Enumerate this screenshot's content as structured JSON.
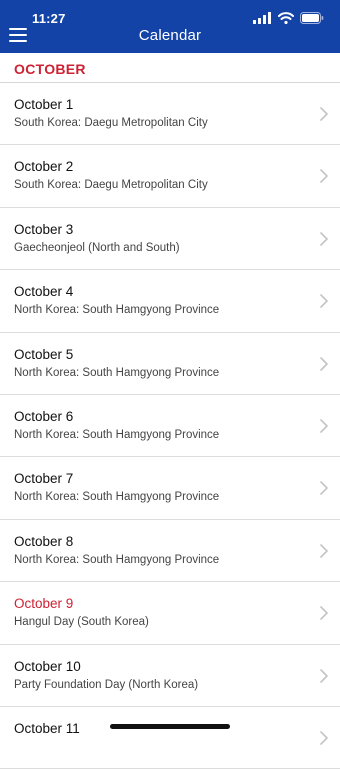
{
  "status_bar": {
    "time": "11:27"
  },
  "nav": {
    "title": "Calendar",
    "menu_icon": "hamburger-menu-icon"
  },
  "section": {
    "title": "OCTOBER"
  },
  "rows": [
    {
      "date": "October 1",
      "subtitle": "South Korea: Daegu Metropolitan City",
      "highlight": false
    },
    {
      "date": "October 2",
      "subtitle": "South Korea: Daegu Metropolitan City",
      "highlight": false
    },
    {
      "date": "October 3",
      "subtitle": "Gaecheonjeol (North and South)",
      "highlight": false
    },
    {
      "date": "October 4",
      "subtitle": "North Korea: South Hamgyong Province",
      "highlight": false
    },
    {
      "date": "October 5",
      "subtitle": "North Korea: South Hamgyong Province",
      "highlight": false
    },
    {
      "date": "October 6",
      "subtitle": "North Korea: South Hamgyong Province",
      "highlight": false
    },
    {
      "date": "October 7",
      "subtitle": "North Korea: South Hamgyong Province",
      "highlight": false
    },
    {
      "date": "October 8",
      "subtitle": "North Korea: South Hamgyong Province",
      "highlight": false
    },
    {
      "date": "October 9",
      "subtitle": "Hangul Day (South Korea)",
      "highlight": true
    },
    {
      "date": "October 10",
      "subtitle": "Party Foundation Day (North Korea)",
      "highlight": false
    },
    {
      "date": "October 11",
      "subtitle": "",
      "highlight": false
    }
  ],
  "colors": {
    "nav_background": "#1443a8",
    "accent_red": "#cc2233",
    "divider": "#dcdcdc"
  }
}
